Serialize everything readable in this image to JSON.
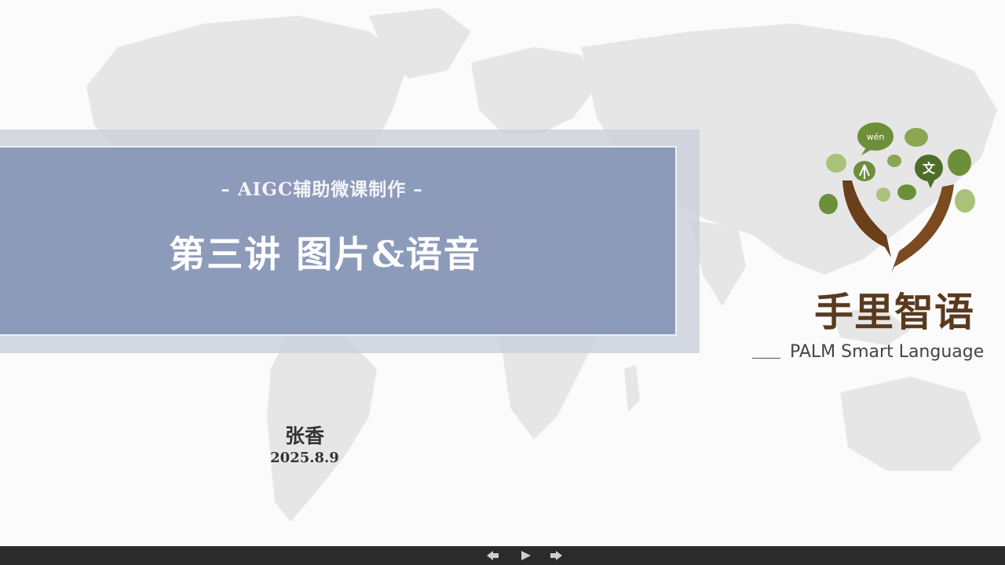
{
  "slide": {
    "subtitle": "– AIGC辅助微课制作 –",
    "title": "第三讲 图片&语音",
    "author": "张香",
    "date": "2025.8.9"
  },
  "logo": {
    "brand_cn": "手里智语",
    "brand_en": "PALM Smart Language",
    "bubble_text_1": "wén",
    "bubble_text_2": "文",
    "colors": {
      "leaf_dark": "#6e8f3a",
      "leaf_light": "#a9c27a",
      "hand_brown": "#6b3f1a"
    }
  },
  "controls": {
    "prev_icon": "prev-slide-icon",
    "play_icon": "play-icon",
    "next_icon": "next-slide-icon"
  }
}
